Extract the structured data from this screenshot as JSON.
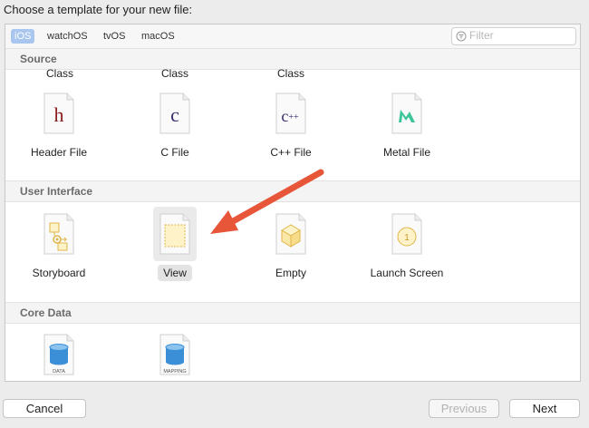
{
  "dialog": {
    "title": "Choose a template for your new file:"
  },
  "platform_tabs": [
    {
      "label": "iOS",
      "selected": true
    },
    {
      "label": "watchOS",
      "selected": false
    },
    {
      "label": "tvOS",
      "selected": false
    },
    {
      "label": "macOS",
      "selected": false
    }
  ],
  "filter": {
    "placeholder": "Filter",
    "value": ""
  },
  "sections": {
    "source": {
      "header": "Source",
      "partial_labels": [
        "Class",
        "Class",
        "Class"
      ],
      "items": [
        {
          "label": "Header File",
          "icon": "h",
          "icon_color": "#8b1c1c"
        },
        {
          "label": "C File",
          "icon": "c",
          "icon_color": "#3b2a6b"
        },
        {
          "label": "C++ File",
          "icon": "c++",
          "icon_color": "#3b2a6b"
        },
        {
          "label": "Metal File",
          "icon": "metal",
          "icon_color": "#3cc59a"
        }
      ]
    },
    "user_interface": {
      "header": "User Interface",
      "items": [
        {
          "label": "Storyboard",
          "icon": "storyboard"
        },
        {
          "label": "View",
          "icon": "view",
          "selected": true
        },
        {
          "label": "Empty",
          "icon": "empty"
        },
        {
          "label": "Launch Screen",
          "icon": "launch-screen"
        }
      ]
    },
    "core_data": {
      "header": "Core Data",
      "items": [
        {
          "label": "",
          "icon_text": "DATA"
        },
        {
          "label": "",
          "icon_text": "MAPPING"
        }
      ]
    }
  },
  "buttons": {
    "cancel": "Cancel",
    "previous": "Previous",
    "next": "Next"
  },
  "colors": {
    "accent": "#a8c6ee",
    "arrow": "#e8563a"
  }
}
